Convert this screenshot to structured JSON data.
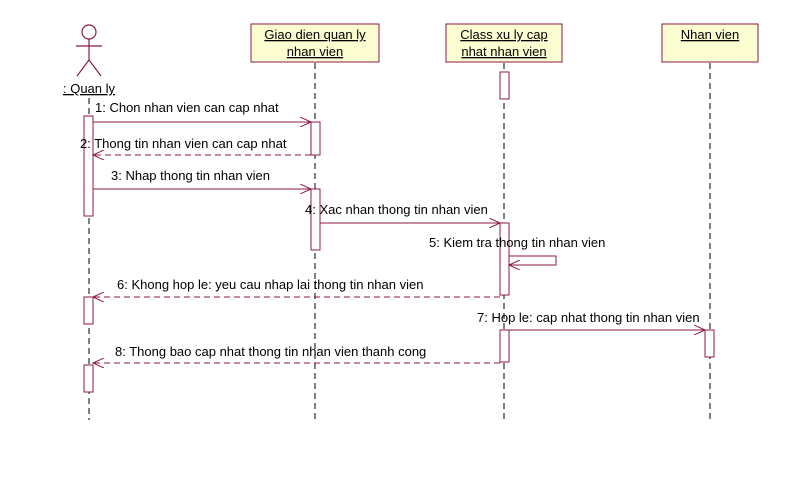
{
  "colors": {
    "accent": "#8b1a4a",
    "box_fill": "#fdfdd2",
    "background": "#ffffff"
  },
  "actor": {
    "label": ": Quan ly"
  },
  "objects": [
    {
      "line1": "Giao dien quan ly",
      "line2": "nhan vien"
    },
    {
      "line1": "Class xu ly cap",
      "line2": "nhat nhan vien"
    },
    {
      "line1": "Nhan vien",
      "line2": ""
    }
  ],
  "messages": [
    {
      "label": "1: Chon nhan vien can cap nhat"
    },
    {
      "label": "2: Thong tin nhan vien can cap nhat"
    },
    {
      "label": "3: Nhap thong tin nhan vien"
    },
    {
      "label": "4: Xac nhan thong tin nhan vien"
    },
    {
      "label": "5: Kiem tra thong tin nhan vien"
    },
    {
      "label": "6: Khong hop le: yeu cau nhap lai thong tin nhan vien"
    },
    {
      "label": "7: Hop le: cap nhat thong tin nhan vien"
    },
    {
      "label": "8: Thong bao cap nhat thong tin nhan vien thanh cong"
    }
  ]
}
